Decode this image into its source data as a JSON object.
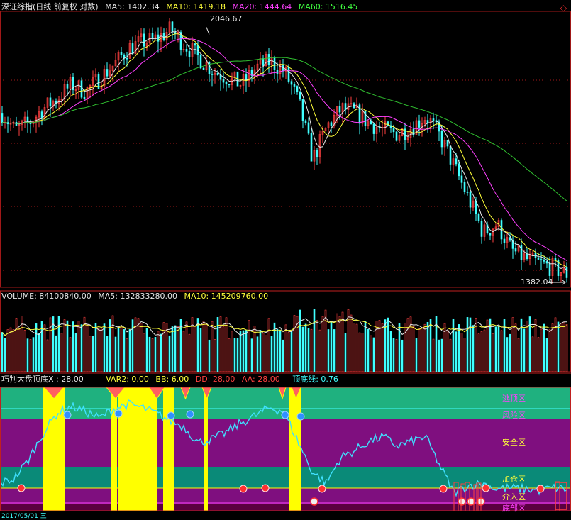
{
  "header": {
    "title": "深证综指(日线 前复权 对数)",
    "ma5": "MA5: 1402.34",
    "ma10": "MA10: 1419.18",
    "ma20": "MA20: 1444.64",
    "ma60": "MA60: 1516.45",
    "corner_icon": "◇"
  },
  "volume_header": {
    "vol": "VOLUME: 84100840.00",
    "ma5": "MA5: 132833280.00",
    "ma10": "MA10: 145209760.00"
  },
  "indicator_header": {
    "name": "巧判大盘顶底X : 28.00",
    "var2": "VAR2: 0.00",
    "bb": "BB: 6.00",
    "dd": "DD: 28.00",
    "aa": "AA: 28.00",
    "top_line": "顶底线: 0.76"
  },
  "zones": {
    "escape": "逃顶区",
    "risk": "风险区",
    "safe": "安全区",
    "add": "加仓区",
    "enter": "介入区",
    "bottom": "底部区"
  },
  "price_labels": {
    "high": "2046.67",
    "low": "1382.04"
  },
  "bottom_date": "2017/05/01 三",
  "colors": {
    "up": "#ff4040",
    "down": "#40ffff",
    "ma5": "#e6e6e6",
    "ma10": "#ffff3a",
    "ma20": "#ff40ff",
    "ma60": "#30c030",
    "escape_band": "#1fb17f",
    "safe_band": "#7f0f7f",
    "add_band": "#0a8a78",
    "yellow_signal": "#ffff00",
    "indicator_line": "#40e0ff"
  },
  "chart_data": [
    {
      "type": "line",
      "scale": "log",
      "x": [
        1,
        20,
        40,
        60,
        80,
        100,
        120,
        140,
        160,
        180,
        200,
        220,
        240,
        260,
        280,
        300,
        320,
        340,
        360,
        380,
        400,
        420,
        440,
        460,
        480,
        500,
        520,
        540,
        560,
        580,
        600,
        620,
        640,
        660,
        680,
        700,
        720,
        740,
        760,
        780,
        800
      ],
      "series": [
        {
          "name": "close",
          "values": [
            1790,
            1740,
            1760,
            1800,
            1830,
            1870,
            1850,
            1890,
            1930,
            1980,
            2000,
            2010,
            2040,
            1990,
            1950,
            1910,
            1890,
            1870,
            1920,
            1940,
            1910,
            1820,
            1660,
            1750,
            1800,
            1790,
            1760,
            1740,
            1730,
            1750,
            1780,
            1720,
            1640,
            1560,
            1480,
            1500,
            1440,
            1420,
            1410,
            1400,
            1385
          ]
        }
      ],
      "high_label_value": 2046.67,
      "low_label_value": 1382.04
    },
    {
      "type": "bar",
      "ylabel": "VOLUME"
    },
    {
      "type": "line",
      "series": [
        {
          "values": [
            20,
            24,
            40,
            62,
            80,
            86,
            82,
            76,
            84,
            88,
            85,
            80,
            74,
            68,
            55,
            58,
            64,
            72,
            78,
            85,
            82,
            56,
            30,
            20,
            42,
            48,
            56,
            60,
            52,
            56,
            60,
            35,
            12,
            18,
            20,
            15,
            16,
            15,
            14,
            16,
            15
          ]
        }
      ],
      "ylim": [
        0,
        100
      ]
    }
  ]
}
